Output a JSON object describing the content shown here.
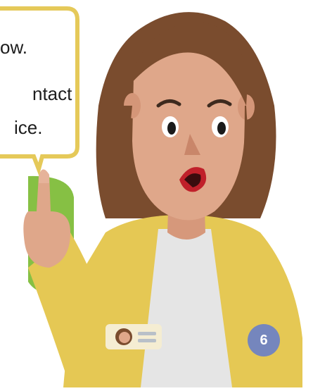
{
  "bubble": {
    "line1": "ow.",
    "line2": "ntact",
    "line3": "ice."
  },
  "step_badge": {
    "number": "6",
    "color": "#7586bd"
  },
  "colors": {
    "bubble_border": "#e5c959",
    "hair": "#7a4c2e",
    "skin": "#dfa78a",
    "cardigan": "#e5c854",
    "shirt": "#e5e5e5",
    "green_panel": "#86c044"
  },
  "icons": [
    "speech-bubble-icon",
    "name-badge-icon",
    "pointing-hand-icon"
  ]
}
